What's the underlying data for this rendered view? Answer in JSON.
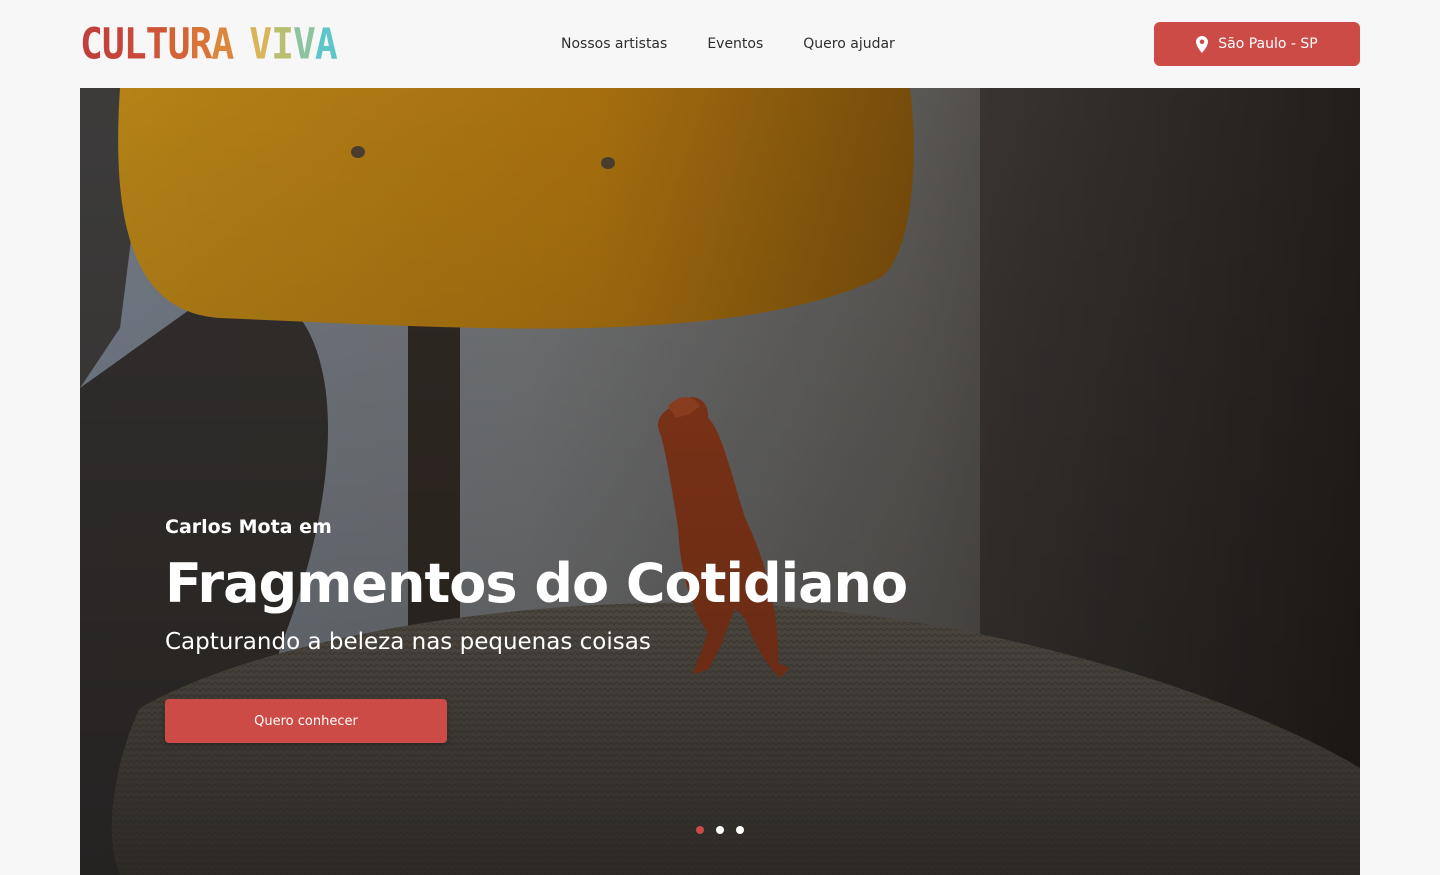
{
  "brand": {
    "logo_word1": "CULTURA",
    "logo_word2": "VIVA",
    "logo_colors_word1": [
      "#c2403b",
      "#c5443a",
      "#c94a39",
      "#cd5638",
      "#d26437",
      "#d87438",
      "#dd873c"
    ],
    "logo_colors_word2": [
      "#d9b459",
      "#b9bf70",
      "#8ec3a0",
      "#5fc6c8"
    ]
  },
  "nav": {
    "items": [
      {
        "label": "Nossos artistas"
      },
      {
        "label": "Eventos"
      },
      {
        "label": "Quero ajudar"
      }
    ]
  },
  "location": {
    "label": "São Paulo - SP",
    "icon": "map-pin-icon"
  },
  "hero": {
    "subtitle": "Carlos Mota em",
    "title": "Fragmentos do Cotidiano",
    "tagline": "Capturando a beleza nas pequenas coisas",
    "cta_label": "Quero conhecer",
    "slides_total": 3,
    "active_slide": 1
  },
  "colors": {
    "accent": "#cc4b47",
    "background": "#f7f7f7",
    "nav_text": "#2e2e2e",
    "dot_inactive": "#ffffff",
    "dot_active": "#cc4b47"
  }
}
